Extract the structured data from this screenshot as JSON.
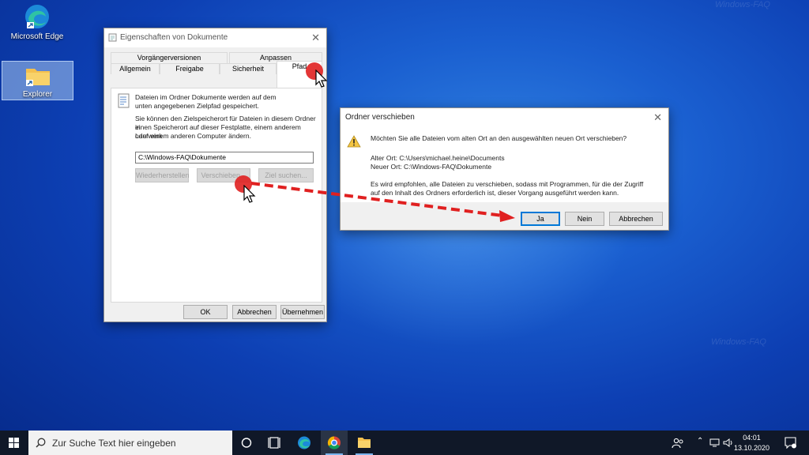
{
  "desktop": {
    "icons": [
      {
        "label": "Microsoft Edge",
        "icon": "edge-icon"
      },
      {
        "label": "Explorer",
        "icon": "folder-icon"
      }
    ],
    "watermarks": [
      "Windows-FAQ",
      "Windows-FAQ"
    ]
  },
  "properties_window": {
    "title": "Eigenschaften von Dokumente",
    "tabs_row1": [
      "Vorgängerversionen",
      "Anpassen"
    ],
    "tabs_row2": [
      "Allgemein",
      "Freigabe",
      "Sicherheit",
      "Pfad"
    ],
    "active_tab": "Pfad",
    "info_text_1": "Dateien im Ordner Dokumente werden auf dem",
    "info_text_2": "unten angegebenen Zielpfad gespeichert.",
    "desc_1": "Sie können den Zielspeicherort für Dateien in diesem Ordner in",
    "desc_2": "einen Speicherort auf dieser Festplatte, einem anderem Laufwerk",
    "desc_3": "oder einem anderen Computer ändern.",
    "path_value": "C:\\Windows-FAQ\\Dokumente",
    "buttons": {
      "restore": "Wiederherstellen",
      "move": "Verschieben...",
      "find_target": "Ziel suchen...",
      "ok": "OK",
      "cancel": "Abbrechen",
      "apply": "Übernehmen"
    }
  },
  "move_dialog": {
    "title": "Ordner verschieben",
    "question": "Möchten Sie alle Dateien vom alten Ort an den ausgewählten neuen Ort verschieben?",
    "old_location": "Alter Ort: C:\\Users\\michael.heine\\Documents",
    "new_location": "Neuer Ort: C:\\Windows-FAQ\\Dokumente",
    "recommendation_1": "Es wird empfohlen, alle Dateien zu verschieben, sodass mit Programmen, für die der Zugriff",
    "recommendation_2": "auf den Inhalt des Ordners erforderlich ist, dieser Vorgang ausgeführt werden kann.",
    "buttons": {
      "yes": "Ja",
      "no": "Nein",
      "cancel": "Abbrechen"
    }
  },
  "taskbar": {
    "search_placeholder": "Zur Suche Text hier eingeben",
    "time": "04:01",
    "date": "13.10.2020",
    "pinned": [
      "task-view-icon",
      "edge-icon",
      "chrome-icon",
      "file-explorer-icon"
    ]
  },
  "colors": {
    "accent": "#0078d7",
    "annotation_red": "#e02020",
    "taskbar": "#101828"
  }
}
